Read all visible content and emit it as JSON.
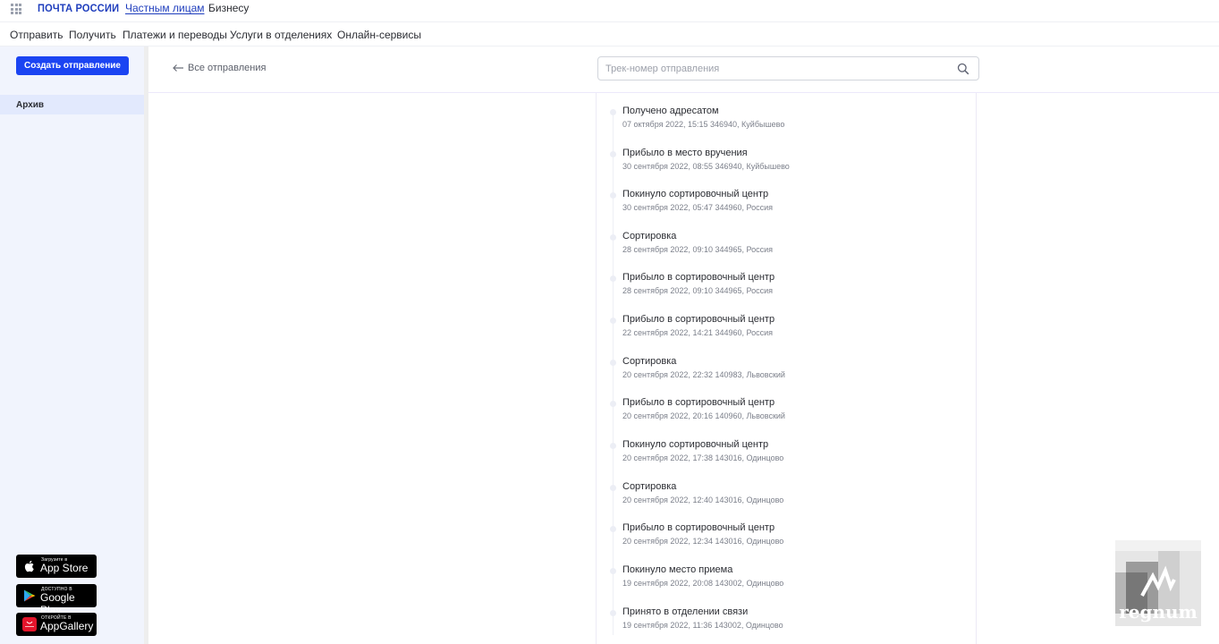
{
  "header": {
    "brand": "ПОЧТА РОССИИ",
    "audience_tabs": [
      {
        "label": "Частным лицам",
        "active": true
      },
      {
        "label": "Бизнесу",
        "active": false
      }
    ]
  },
  "nav": {
    "items": [
      "Отправить",
      "Получить",
      "Платежи и переводы",
      "Услуги в отделениях",
      "Онлайн-сервисы"
    ]
  },
  "sidebar": {
    "create_button": "Создать отправление",
    "items": [
      {
        "label": "Архив",
        "active": true
      }
    ],
    "stores": [
      {
        "small": "Загрузите в",
        "big": "App Store",
        "icon": "apple-icon"
      },
      {
        "small": "ДОСТУПНО В",
        "big": "Google Play",
        "icon": "google-play-icon"
      },
      {
        "small": "ОТКРОЙТЕ В",
        "big": "AppGallery",
        "icon": "huawei-appgallery-icon"
      }
    ]
  },
  "main": {
    "back_link": "Все отправления",
    "search": {
      "placeholder": "Трек-номер отправления",
      "value": ""
    },
    "events": [
      {
        "title": "Получено адресатом",
        "meta": "07 октября 2022, 15:15 346940, Куйбышево"
      },
      {
        "title": "Прибыло в место вручения",
        "meta": "30 сентября 2022, 08:55 346940, Куйбышево"
      },
      {
        "title": "Покинуло сортировочный центр",
        "meta": "30 сентября 2022, 05:47 344960, Россия"
      },
      {
        "title": "Сортировка",
        "meta": "28 сентября 2022, 09:10 344965, Россия"
      },
      {
        "title": "Прибыло в сортировочный центр",
        "meta": "28 сентября 2022, 09:10 344965, Россия"
      },
      {
        "title": "Прибыло в сортировочный центр",
        "meta": "22 сентября 2022, 14:21 344960, Россия"
      },
      {
        "title": "Сортировка",
        "meta": "20 сентября 2022, 22:32 140983, Львовский"
      },
      {
        "title": "Прибыло в сортировочный центр",
        "meta": "20 сентября 2022, 20:16 140960, Львовский"
      },
      {
        "title": "Покинуло сортировочный центр",
        "meta": "20 сентября 2022, 17:38 143016, Одинцово"
      },
      {
        "title": "Сортировка",
        "meta": "20 сентября 2022, 12:40 143016, Одинцово"
      },
      {
        "title": "Прибыло в сортировочный центр",
        "meta": "20 сентября 2022, 12:34 143016, Одинцово"
      },
      {
        "title": "Покинуло место приема",
        "meta": "19 сентября 2022, 20:08 143002, Одинцово"
      },
      {
        "title": "Принято в отделении связи",
        "meta": "19 сентября 2022, 11:36 143002, Одинцово"
      }
    ]
  },
  "watermark": {
    "text": "regnum"
  },
  "colors": {
    "brand": "#1f3ebd",
    "button": "#1b44f2",
    "sidebar_bg": "#f1f4fd",
    "sidebar_active": "#e2e9fd"
  }
}
